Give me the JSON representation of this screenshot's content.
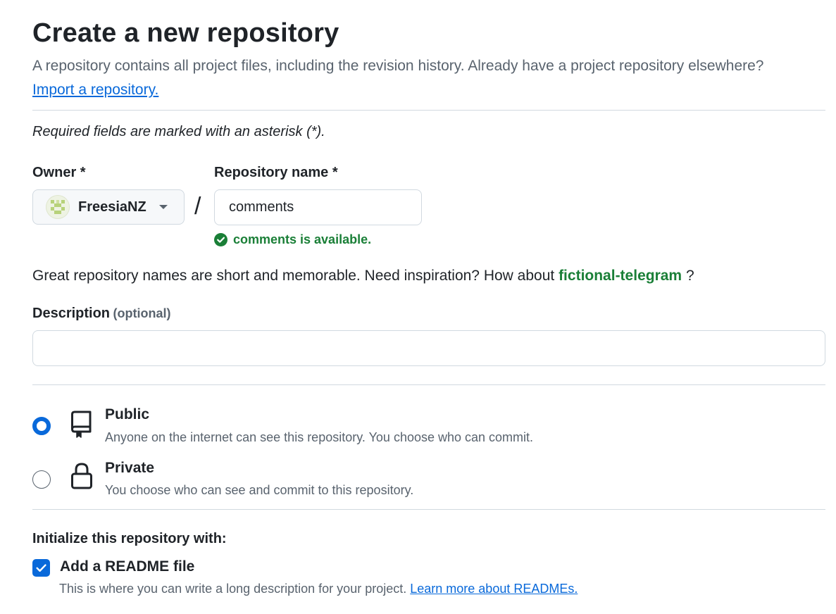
{
  "header": {
    "title": "Create a new repository",
    "subtitle": "A repository contains all project files, including the revision history. Already have a project repository elsewhere?",
    "import_link": "Import a repository."
  },
  "form": {
    "required_note": "Required fields are marked with an asterisk (*).",
    "owner": {
      "label": "Owner *",
      "value": "FreesiaNZ"
    },
    "separator": "/",
    "repo_name": {
      "label": "Repository name *",
      "value": "comments",
      "availability": "comments is available."
    },
    "inspiration": {
      "text": "Great repository names are short and memorable. Need inspiration? How about",
      "suggestion": "fictional-telegram",
      "suffix": "?"
    },
    "description": {
      "label": "Description",
      "optional": "(optional)",
      "value": ""
    },
    "visibility": {
      "selected": "public",
      "options": [
        {
          "id": "public",
          "title": "Public",
          "description": "Anyone on the internet can see this repository. You choose who can commit.",
          "icon": "repo-icon"
        },
        {
          "id": "private",
          "title": "Private",
          "description": "You choose who can see and commit to this repository.",
          "icon": "lock-icon"
        }
      ]
    },
    "initialize": {
      "heading": "Initialize this repository with:",
      "readme": {
        "label": "Add a README file",
        "checked": true,
        "description": "This is where you can write a long description for your project.",
        "link": "Learn more about READMEs."
      }
    }
  },
  "colors": {
    "accent": "#0969da",
    "success": "#1a7f37",
    "muted": "#59636e",
    "border": "#d1d9e0"
  }
}
